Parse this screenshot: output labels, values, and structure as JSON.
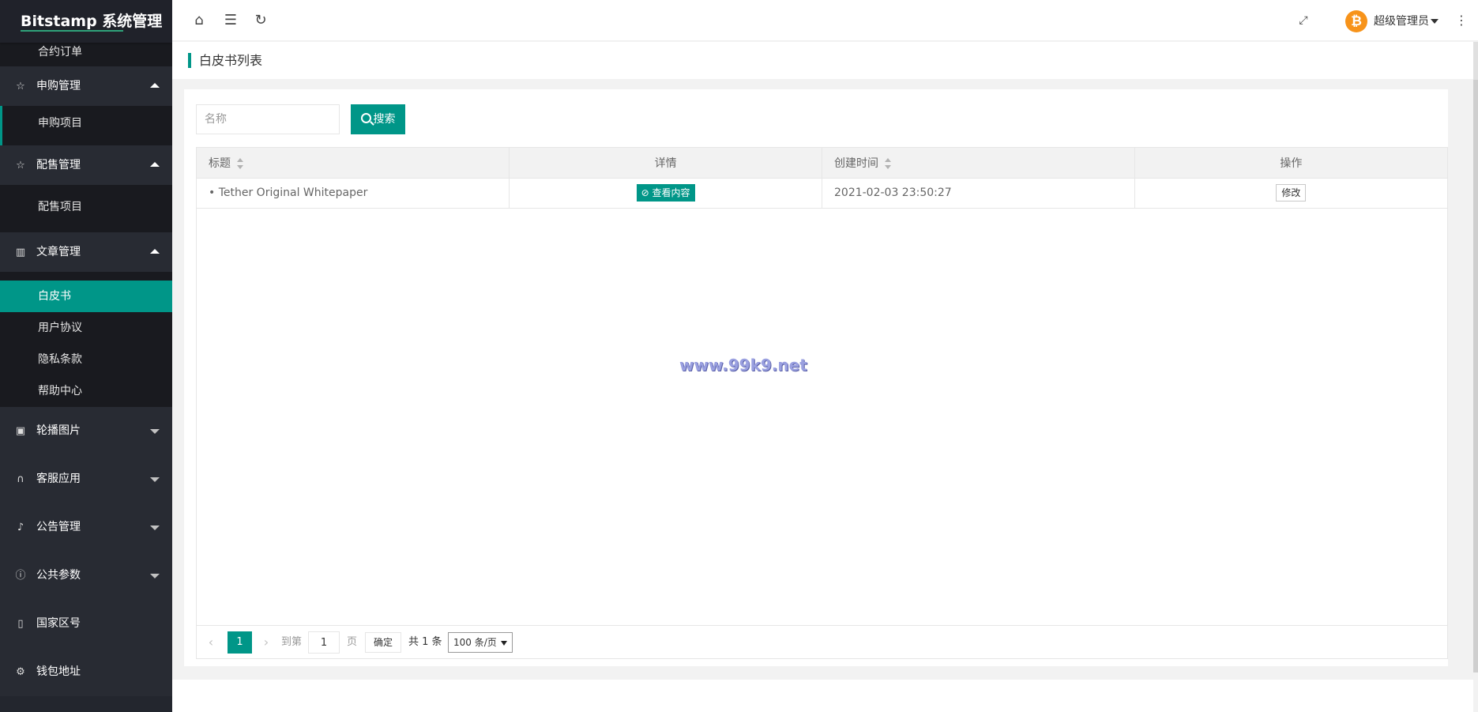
{
  "app": {
    "title": "Bitstamp 系统管理"
  },
  "sidebar": {
    "top_partial_item": "合约订单",
    "groups": [
      {
        "label": "申购管理",
        "icon": "star-icon",
        "expanded": true,
        "children": [
          "申购项目"
        ]
      },
      {
        "label": "配售管理",
        "icon": "star-icon",
        "expanded": true,
        "children": [
          "配售项目"
        ]
      },
      {
        "label": "文章管理",
        "icon": "book-icon",
        "expanded": true,
        "children": [
          "白皮书",
          "用户协议",
          "隐私条款",
          "帮助中心"
        ]
      },
      {
        "label": "轮播图片",
        "icon": "image-icon",
        "expanded": false
      },
      {
        "label": "客服应用",
        "icon": "headset-icon",
        "expanded": false
      },
      {
        "label": "公告管理",
        "icon": "bell-icon",
        "expanded": false
      },
      {
        "label": "公共参数",
        "icon": "info-icon",
        "expanded": false
      },
      {
        "label": "国家区号",
        "icon": "phone-icon",
        "expanded": false
      },
      {
        "label": "钱包地址",
        "icon": "gear-icon",
        "expanded": false
      }
    ],
    "active_item": "白皮书"
  },
  "topbar": {
    "icons": [
      "home-icon",
      "menu-fold-icon",
      "refresh-icon",
      "fullscreen-icon",
      "more-vertical-icon"
    ],
    "user_name": "超级管理员",
    "avatar_symbol": "₿"
  },
  "page": {
    "title": "白皮书列表"
  },
  "search": {
    "placeholder": "名称",
    "value": "",
    "button_label": "搜索"
  },
  "table": {
    "columns": [
      "标题",
      "详情",
      "创建时间",
      "操作"
    ],
    "rows": [
      {
        "title": "• Tether Original Whitepaper",
        "detail_button": "查看内容",
        "created_at": "2021-02-03 23:50:27",
        "action_button": "修改"
      }
    ]
  },
  "watermark": "www.99k9.net",
  "pagination": {
    "prev": "‹",
    "next": "›",
    "current_page": "1",
    "goto_label": "到第",
    "goto_value": "1",
    "page_unit": "页",
    "confirm": "确定",
    "total": "共 1 条",
    "page_size": "100 条/页"
  },
  "colors": {
    "accent": "#009688",
    "sidebar_bg": "#23262e",
    "avatar": "#f7931a"
  }
}
